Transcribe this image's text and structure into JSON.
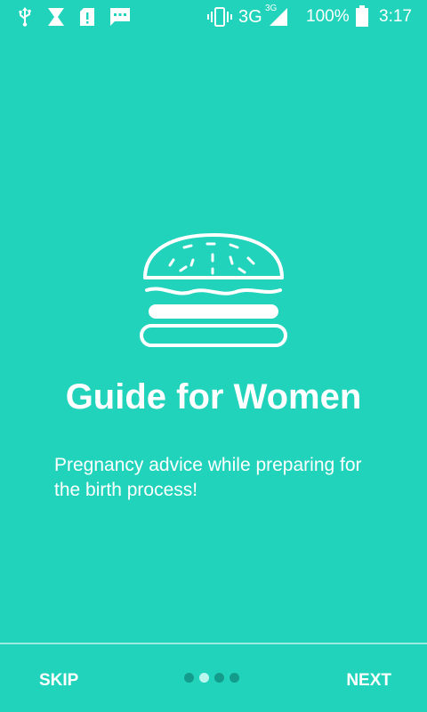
{
  "status_bar": {
    "network": "3G",
    "network_superscript": "3G",
    "battery": "100%",
    "time": "3:17",
    "icons": [
      "usb-icon",
      "hourglass-icon",
      "sim-alert-icon",
      "message-icon",
      "vibrate-icon",
      "signal-icon",
      "battery-icon"
    ]
  },
  "onboarding": {
    "hero_icon": "burger-icon",
    "title": "Guide for Women",
    "description": "Pregnancy advice while preparing for the birth process!",
    "page_count": 4,
    "current_page": 2
  },
  "footer": {
    "skip_label": "SKIP",
    "next_label": "NEXT"
  },
  "colors": {
    "background": "#22D3BC",
    "text": "#FFFFFF",
    "dot_active": "#B9F6EE",
    "dot_inactive": "#139C8B"
  }
}
